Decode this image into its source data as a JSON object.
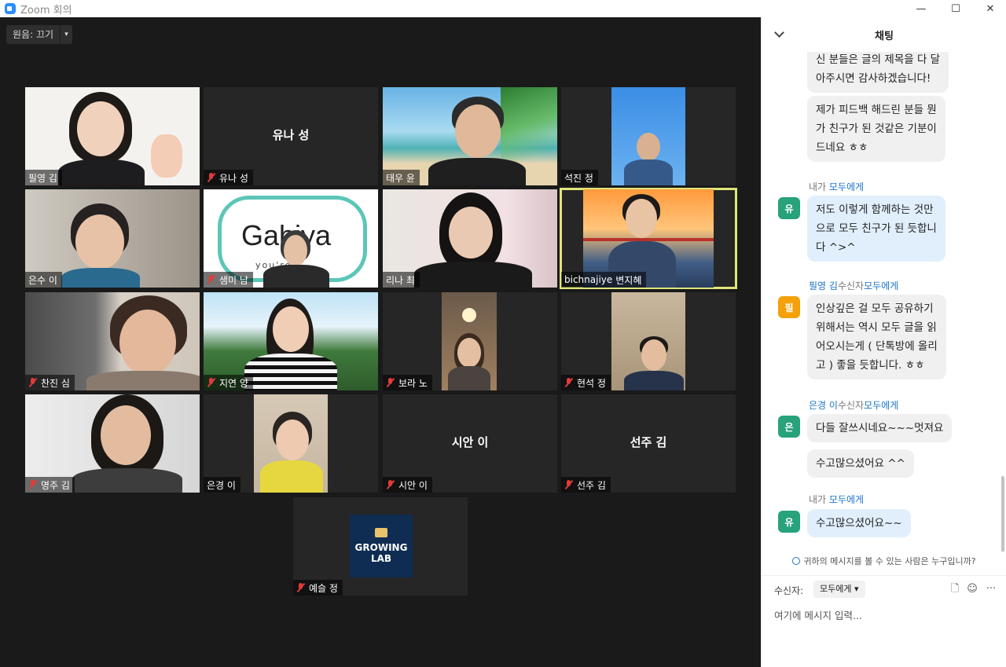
{
  "window": {
    "title": "Zoom 회의",
    "minimize": "—",
    "maximize": "☐",
    "close": "✕"
  },
  "toolbar": {
    "sound_label": "원음: 끄기",
    "sound_caret": "▾"
  },
  "participants": [
    {
      "name": "필영 김",
      "muted": false,
      "video": true
    },
    {
      "name": "유나 성",
      "muted": true,
      "video": false,
      "center": "유나 성"
    },
    {
      "name": "태우 윤",
      "muted": false,
      "video": true
    },
    {
      "name": "석진 정",
      "muted": false,
      "video": true
    },
    {
      "name": "은수 이",
      "muted": false,
      "video": true
    },
    {
      "name": "샘미 남",
      "muted": true,
      "video": true,
      "background_logo": "Gabiya",
      "background_sub": "you're"
    },
    {
      "name": "리나 최",
      "muted": false,
      "video": true
    },
    {
      "name": "변지혜",
      "prefix": "bichnajiye",
      "muted": false,
      "video": true,
      "active": true
    },
    {
      "name": "찬진 심",
      "muted": true,
      "video": true
    },
    {
      "name": "지연 양",
      "muted": true,
      "video": true
    },
    {
      "name": "보라 노",
      "muted": true,
      "video": true
    },
    {
      "name": "현석 정",
      "muted": true,
      "video": true
    },
    {
      "name": "명주 김",
      "muted": true,
      "video": true
    },
    {
      "name": "은경 이",
      "muted": false,
      "video": true
    },
    {
      "name": "시안 이",
      "muted": true,
      "video": false,
      "center": "시안 이"
    },
    {
      "name": "선주 김",
      "muted": true,
      "video": false,
      "center": "선주 김"
    },
    {
      "name": "예슬 정",
      "muted": true,
      "video": false,
      "logo_line1": "GROWING",
      "logo_line2": "LAB"
    }
  ],
  "chat": {
    "title": "채팅",
    "messages": [
      {
        "text_lines": [
          "신 분들은 글의 제목을 다 달",
          "아주시면 감사하겠습니다!"
        ]
      },
      {
        "text_lines": [
          "제가 피드백 해드린 분들 뭔",
          "가 친구가 된 것같은 기분이",
          "드네요 ㅎㅎ"
        ]
      },
      {
        "sender": "내가",
        "to": "모두에게",
        "avatar": "유",
        "avatar_color": "#27a27b",
        "text_lines": [
          "저도 이렇게 함께하는 것만",
          "으로 모두 친구가 된 듯합니",
          "다 ^>^"
        ]
      },
      {
        "sender": "필영 김",
        "sep": "수신자",
        "to": "모두에게",
        "avatar": "필",
        "avatar_color": "#f4a10b",
        "text_lines": [
          "인상깊은 걸 모두 공유하기",
          "위해서는 역시 모두 글을 읽",
          "어오시는게 ( 단톡방에 올리",
          "고 ) 좋을 듯합니다. ㅎㅎ"
        ]
      },
      {
        "sender": "은경 이",
        "sep": "수신자",
        "to": "모두에게",
        "avatar": "은",
        "avatar_color": "#27a27b",
        "text_lines": [
          "다들 잘쓰시네요~~~멋져요"
        ]
      },
      {
        "text_lines": [
          "수고많으셨어요 ^^"
        ]
      },
      {
        "sender": "내가",
        "to": "모두에게",
        "avatar": "유",
        "avatar_color": "#27a27b",
        "text_lines": [
          "수고많으셨어요~~"
        ]
      }
    ],
    "who_can_see": "귀하의 메시지를 볼 수 있는 사람은 누구입니까?",
    "recipient_label": "수신자:",
    "recipient_value": "모두에게",
    "input_placeholder": "여기에 메시지 입력...",
    "more": "···"
  }
}
